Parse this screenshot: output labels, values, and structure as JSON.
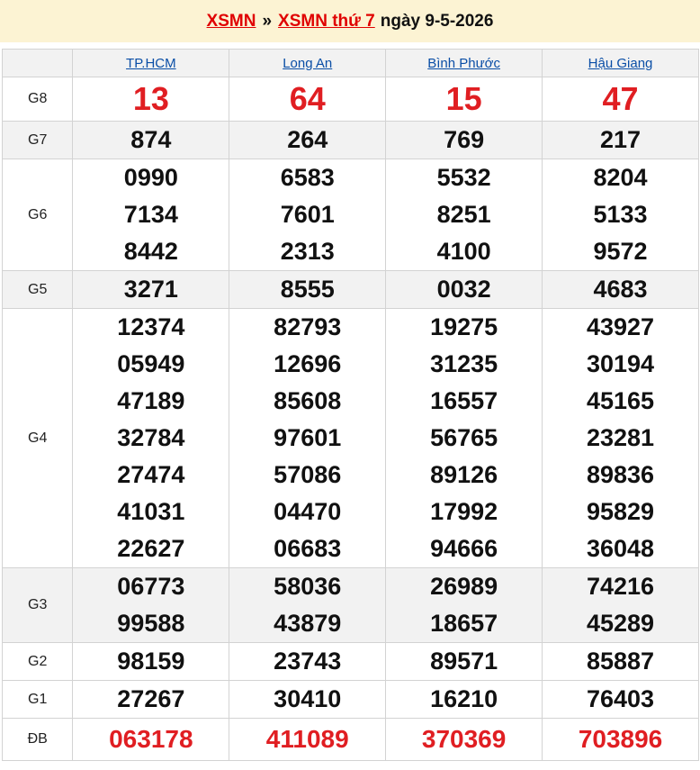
{
  "header": {
    "link1": "XSMN",
    "separator": "»",
    "link2": "XSMN thứ 7",
    "date_text": "ngày 9-5-2026"
  },
  "provinces": [
    "TP.HCM",
    "Long An",
    "Bình Phước",
    "Hậu Giang"
  ],
  "prizes": [
    {
      "label": "G8",
      "style": "big-red",
      "alt": false,
      "values": [
        [
          "13"
        ],
        [
          "64"
        ],
        [
          "15"
        ],
        [
          "47"
        ]
      ]
    },
    {
      "label": "G7",
      "style": "normal",
      "alt": true,
      "values": [
        [
          "874"
        ],
        [
          "264"
        ],
        [
          "769"
        ],
        [
          "217"
        ]
      ]
    },
    {
      "label": "G6",
      "style": "normal",
      "alt": false,
      "values": [
        [
          "0990",
          "7134",
          "8442"
        ],
        [
          "6583",
          "7601",
          "2313"
        ],
        [
          "5532",
          "8251",
          "4100"
        ],
        [
          "8204",
          "5133",
          "9572"
        ]
      ]
    },
    {
      "label": "G5",
      "style": "normal",
      "alt": true,
      "values": [
        [
          "3271"
        ],
        [
          "8555"
        ],
        [
          "0032"
        ],
        [
          "4683"
        ]
      ]
    },
    {
      "label": "G4",
      "style": "normal",
      "alt": false,
      "values": [
        [
          "12374",
          "05949",
          "47189",
          "32784",
          "27474",
          "41031",
          "22627"
        ],
        [
          "82793",
          "12696",
          "85608",
          "97601",
          "57086",
          "04470",
          "06683"
        ],
        [
          "19275",
          "31235",
          "16557",
          "56765",
          "89126",
          "17992",
          "94666"
        ],
        [
          "43927",
          "30194",
          "45165",
          "23281",
          "89836",
          "95829",
          "36048"
        ]
      ]
    },
    {
      "label": "G3",
      "style": "normal",
      "alt": true,
      "values": [
        [
          "06773",
          "99588"
        ],
        [
          "58036",
          "43879"
        ],
        [
          "26989",
          "18657"
        ],
        [
          "74216",
          "45289"
        ]
      ]
    },
    {
      "label": "G2",
      "style": "normal",
      "alt": false,
      "values": [
        [
          "98159"
        ],
        [
          "23743"
        ],
        [
          "89571"
        ],
        [
          "85887"
        ]
      ]
    },
    {
      "label": "G1",
      "style": "normal",
      "alt": false,
      "values": [
        [
          "27267"
        ],
        [
          "30410"
        ],
        [
          "16210"
        ],
        [
          "76403"
        ]
      ]
    },
    {
      "label": "ĐB",
      "style": "special",
      "alt": false,
      "values": [
        [
          "063178"
        ],
        [
          "411089"
        ],
        [
          "370369"
        ],
        [
          "703896"
        ]
      ]
    }
  ]
}
